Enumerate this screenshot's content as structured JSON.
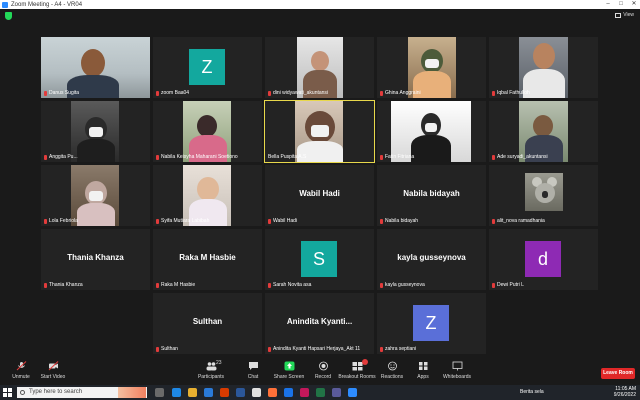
{
  "window": {
    "title": "Zoom Meeting - A4 - VR04"
  },
  "topbar": {
    "view_label": "View"
  },
  "participants": [
    {
      "name": "Danus Sugita",
      "type": "video"
    },
    {
      "name": "zoom Baa04",
      "type": "avatar",
      "initial": "Z",
      "avatar_color": "#13a89e"
    },
    {
      "name": "dini widyawati_akuntansi",
      "type": "video"
    },
    {
      "name": "Ghina Anggraini",
      "type": "video"
    },
    {
      "name": "Iqbal Fathulloh",
      "type": "video"
    },
    {
      "name": "Anggita Pu...",
      "type": "video"
    },
    {
      "name": "Nabila Keisyha Maharani Soetiono",
      "type": "video"
    },
    {
      "name": "Bella Puspita A.S",
      "type": "video",
      "active_speaker": true
    },
    {
      "name": "Fatin Fitriana",
      "type": "video"
    },
    {
      "name": "Ade suryadi_akuntansi",
      "type": "video"
    },
    {
      "name": "Lola Febriola",
      "type": "video"
    },
    {
      "name": "Syifa Mutiara Labibah",
      "type": "video"
    },
    {
      "name": "Wabil Hadi",
      "type": "name",
      "display": "Wabil Hadi"
    },
    {
      "name": "Nabila bidayah",
      "type": "name",
      "display": "Nabila bidayah"
    },
    {
      "name": "alit_nova ramadhania",
      "type": "photo"
    },
    {
      "name": "Thania Khanza",
      "type": "name",
      "display": "Thania Khanza"
    },
    {
      "name": "Raka M Hasbie",
      "type": "name",
      "display": "Raka M Hasbie"
    },
    {
      "name": "Sarah Novita asa",
      "type": "avatar",
      "initial": "S",
      "avatar_color": "#13a89e"
    },
    {
      "name": "kayla gusseynova",
      "type": "name",
      "display": "kayla gusseynova"
    },
    {
      "name": "Dewi Putri L",
      "type": "avatar",
      "initial": "d",
      "avatar_color": "#8e2ab4"
    },
    {
      "name": "Sulthan",
      "type": "name",
      "display": "Sulthan"
    },
    {
      "name": "Anindita Kyanti Hapsari Herjaya_Akt 11",
      "type": "name",
      "display": "Anindita Kyanti..."
    },
    {
      "name": "zahra septiani",
      "type": "avatar",
      "initial": "Z",
      "avatar_color": "#5a6fd8"
    }
  ],
  "toolbar": {
    "unmute": "Unmute",
    "start_video": "Start Video",
    "participants": "Participants",
    "participants_count": "23",
    "chat": "Chat",
    "share_screen": "Share Screen",
    "record": "Record",
    "breakout_rooms": "Breakout Rooms",
    "reactions": "Reactions",
    "apps": "Apps",
    "whiteboards": "Whiteboards",
    "leave": "Leave Room"
  },
  "taskbar": {
    "search_placeholder": "Type here to search",
    "weather": "Berita sela",
    "time": "11:05 AM",
    "date": "9/26/2022"
  },
  "colors": {
    "accent": "#2d8cff",
    "share_green": "#23d959",
    "leave_red": "#e02828",
    "speaker_yellow": "#e8d84b"
  }
}
